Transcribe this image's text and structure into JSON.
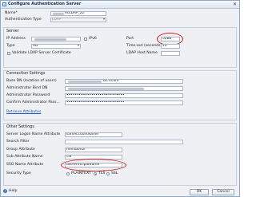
{
  "window": {
    "title": "Configure Authentication Server",
    "close_glyph": "✕"
  },
  "top": {
    "name_label": "Name*",
    "name_value": "                 ",
    "auth_type_label": "Authentication Type",
    "auth_type_value": "LDAP"
  },
  "server": {
    "title": "Server",
    "ip_label": "IP Address",
    "ipv6_label": "IPv6",
    "port_label": "Port",
    "port_value": "5288",
    "type_label": "Type",
    "type_value": "AD",
    "timeout_label": "Time-out (seconds)",
    "timeout_value": "10",
    "validate_label": "Validate LDAP Server Certificate",
    "hostname_label": "LDAP Host Name"
  },
  "connection": {
    "title": "Connection Settings",
    "base_dn_label": "Base DN (location of users)",
    "base_dn_value": "DC=com",
    "bind_dn_label": "Administrator Bind DN",
    "admin_pw_label": "Administrator Password",
    "admin_pw_value": "••••••••••••••••••••••••••••",
    "confirm_pw_label": "Confirm Administrator Pass...",
    "confirm_pw_value": "••••••••••••••••••••••••••••",
    "retrieve_link": "Retrieve Attributes"
  },
  "other": {
    "title": "Other Settings",
    "logon_label": "Server Logon Name Attribute",
    "logon_value": "samAccountName",
    "search_label": "Search Filter",
    "group_label": "Group Attribute",
    "group_value": "memberOf",
    "subattr_label": "Sub Attribute Name",
    "subattr_value": "CN",
    "sso_label": "SSO Name Attribute",
    "sso_value": "userPrincipalName",
    "sectype_label": "Security Type",
    "sectype_options": [
      "PLAINTEXT",
      "TLS",
      "SSL"
    ],
    "sectype_selected": "TLS"
  },
  "footer": {
    "help": "Help",
    "ok": "OK",
    "cancel": "Cancel"
  },
  "colors": {
    "highlight": "#d11a1a",
    "link": "#1b54b5"
  }
}
